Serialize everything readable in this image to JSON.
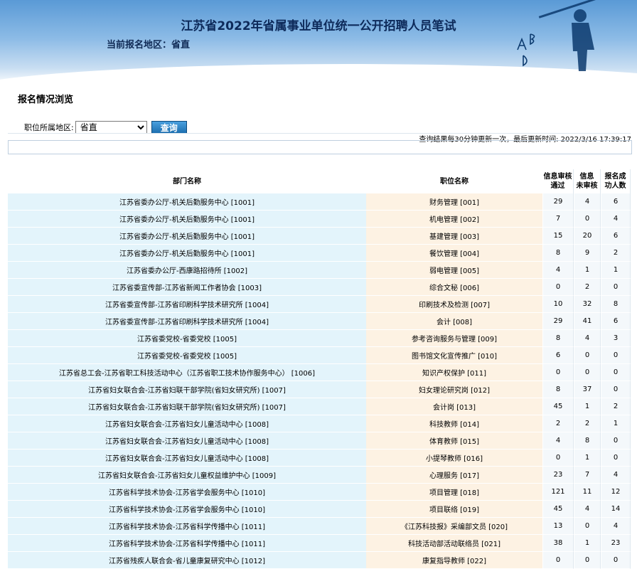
{
  "header": {
    "title": "江苏省2022年省属事业单位统一公开招聘人员笔试",
    "region_label": "当前报名地区：省直"
  },
  "section_title": "报名情况浏览",
  "filter": {
    "label": "职位所属地区:",
    "selected": "省直",
    "query_button": "查询"
  },
  "update_note": "查询结果每30分钟更新一次，最后更新时间: 2022/3/16 17:39:17",
  "table": {
    "headers": {
      "dept": "部门名称",
      "position": "职位名称",
      "passed": [
        "信息审核",
        "通过"
      ],
      "pending": [
        "信息",
        "未审核"
      ],
      "success": [
        "报名成",
        "功人数"
      ]
    },
    "rows": [
      {
        "dept": "江苏省委办公厅-机关后勤服务中心 [1001]",
        "position": "财务管理 [001]",
        "passed": "29",
        "pending": "4",
        "success": "6"
      },
      {
        "dept": "江苏省委办公厅-机关后勤服务中心 [1001]",
        "position": "机电管理 [002]",
        "passed": "7",
        "pending": "0",
        "success": "4"
      },
      {
        "dept": "江苏省委办公厅-机关后勤服务中心 [1001]",
        "position": "基建管理 [003]",
        "passed": "15",
        "pending": "20",
        "success": "6"
      },
      {
        "dept": "江苏省委办公厅-机关后勤服务中心 [1001]",
        "position": "餐饮管理 [004]",
        "passed": "8",
        "pending": "9",
        "success": "2"
      },
      {
        "dept": "江苏省委办公厅-西康路招待所 [1002]",
        "position": "弱电管理 [005]",
        "passed": "4",
        "pending": "1",
        "success": "1"
      },
      {
        "dept": "江苏省委宣传部-江苏省新闻工作者协会 [1003]",
        "position": "综合文秘 [006]",
        "passed": "0",
        "pending": "2",
        "success": "0"
      },
      {
        "dept": "江苏省委宣传部-江苏省印刷科学技术研究所 [1004]",
        "position": "印刷技术及检测 [007]",
        "passed": "10",
        "pending": "32",
        "success": "8"
      },
      {
        "dept": "江苏省委宣传部-江苏省印刷科学技术研究所 [1004]",
        "position": "会计 [008]",
        "passed": "29",
        "pending": "41",
        "success": "6"
      },
      {
        "dept": "江苏省委党校-省委党校 [1005]",
        "position": "参考咨询服务与管理 [009]",
        "passed": "8",
        "pending": "4",
        "success": "3"
      },
      {
        "dept": "江苏省委党校-省委党校 [1005]",
        "position": "图书馆文化宣传推广 [010]",
        "passed": "6",
        "pending": "0",
        "success": "0"
      },
      {
        "dept": "江苏省总工会-江苏省职工科技活动中心（江苏省职工技术协作服务中心） [1006]",
        "position": "知识产权保护 [011]",
        "passed": "0",
        "pending": "0",
        "success": "0"
      },
      {
        "dept": "江苏省妇女联合会-江苏省妇联干部学院(省妇女研究所) [1007]",
        "position": "妇女理论研究岗 [012]",
        "passed": "8",
        "pending": "37",
        "success": "0"
      },
      {
        "dept": "江苏省妇女联合会-江苏省妇联干部学院(省妇女研究所) [1007]",
        "position": "会计岗 [013]",
        "passed": "45",
        "pending": "1",
        "success": "2"
      },
      {
        "dept": "江苏省妇女联合会-江苏省妇女儿童活动中心 [1008]",
        "position": "科技教师 [014]",
        "passed": "2",
        "pending": "2",
        "success": "1"
      },
      {
        "dept": "江苏省妇女联合会-江苏省妇女儿童活动中心 [1008]",
        "position": "体育教师 [015]",
        "passed": "4",
        "pending": "8",
        "success": "0"
      },
      {
        "dept": "江苏省妇女联合会-江苏省妇女儿童活动中心 [1008]",
        "position": "小提琴教师 [016]",
        "passed": "0",
        "pending": "1",
        "success": "0"
      },
      {
        "dept": "江苏省妇女联合会-江苏省妇女儿童权益维护中心 [1009]",
        "position": "心理服务 [017]",
        "passed": "23",
        "pending": "7",
        "success": "4"
      },
      {
        "dept": "江苏省科学技术协会-江苏省学会服务中心 [1010]",
        "position": "项目管理 [018]",
        "passed": "121",
        "pending": "11",
        "success": "12"
      },
      {
        "dept": "江苏省科学技术协会-江苏省学会服务中心 [1010]",
        "position": "项目联络 [019]",
        "passed": "45",
        "pending": "4",
        "success": "14"
      },
      {
        "dept": "江苏省科学技术协会-江苏省科学传播中心 [1011]",
        "position": "《江苏科技报》采编部文员 [020]",
        "passed": "13",
        "pending": "0",
        "success": "4"
      },
      {
        "dept": "江苏省科学技术协会-江苏省科学传播中心 [1011]",
        "position": "科技活动部活动联络员 [021]",
        "passed": "38",
        "pending": "1",
        "success": "23"
      },
      {
        "dept": "江苏省残疾人联合会-省儿童康复研究中心 [1012]",
        "position": "康复指导教师 [022]",
        "passed": "0",
        "pending": "0",
        "success": "0"
      }
    ]
  }
}
